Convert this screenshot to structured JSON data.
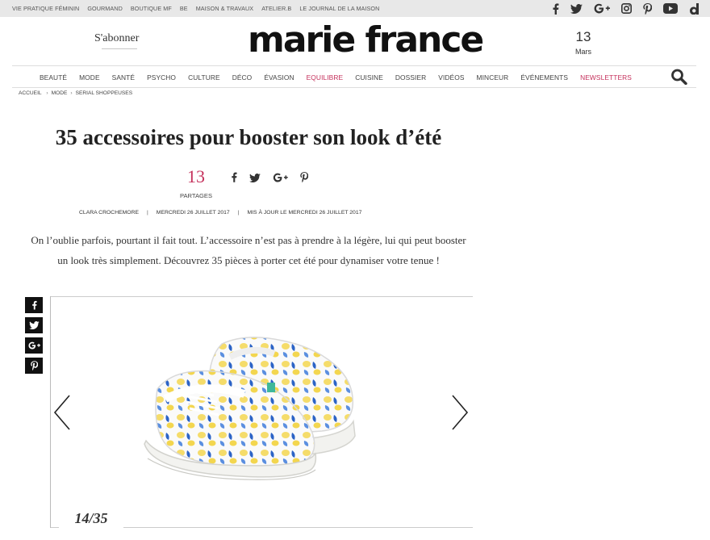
{
  "topbar": {
    "links": [
      "VIE PRATIQUE FÉMININ",
      "GOURMAND",
      "BOUTIQUE MF",
      "BE",
      "MAISON & TRAVAUX",
      "ATELIER.B",
      "LE JOURNAL DE LA MAISON"
    ],
    "social_icons": [
      "facebook-icon",
      "twitter-icon",
      "google-plus-icon",
      "instagram-icon",
      "pinterest-icon",
      "youtube-icon",
      "dailymotion-icon"
    ]
  },
  "header": {
    "subscribe": "S'abonner",
    "logo": "marie france",
    "date_day": "13",
    "date_month": "Mars"
  },
  "nav": {
    "items": [
      "BEAUTÉ",
      "MODE",
      "SANTÉ",
      "PSYCHO",
      "CULTURE",
      "DÉCO",
      "ÉVASION",
      "EQUILIBRE",
      "CUISINE",
      "DOSSIER",
      "VIDÉOS",
      "MINCEUR",
      "ÉVÉNEMENTS",
      "NEWSLETTERS"
    ],
    "accent_color": "#c5305b"
  },
  "breadcrumb": {
    "items": [
      "ACCUEIL",
      "MODE",
      "SERIAL SHOPPEUSES"
    ]
  },
  "article": {
    "title": "35 accessoires pour booster son look d’été",
    "share_count": "13",
    "share_label": "PARTAGES",
    "author": "CLARA CROCHEMORE",
    "published": "MERCREDI 26 JUILLET 2017",
    "updated": "MIS À JOUR LE MERCREDI 26 JUILLET 2017",
    "intro": "On l’oublie parfois, pourtant il fait tout. L’accessoire n’est pas à prendre à la légère, lui qui peut booster un look très simplement. Découvrez 35 pièces à porter cet été pour dynamiser votre tenue !"
  },
  "gallery": {
    "counter": "14/35",
    "image": "white sneakers with lemon print"
  }
}
